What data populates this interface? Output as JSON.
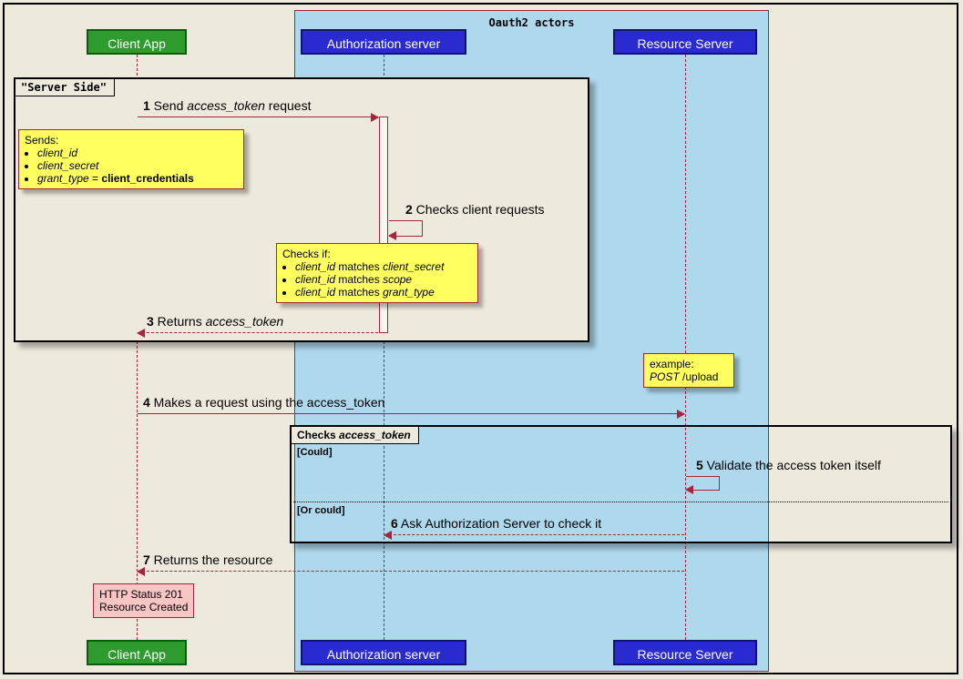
{
  "group_title": "Oauth2 actors",
  "actors": {
    "client": "Client App",
    "auth": "Authorization server",
    "resource": "Resource Server"
  },
  "fragments": {
    "server_side": {
      "label": "\"Server Side\""
    },
    "checks_token": {
      "label_pre": "Checks ",
      "label_em": "access_token",
      "guard1": "[Could]",
      "guard2": "[Or could]"
    }
  },
  "messages": {
    "m1": {
      "num": "1",
      "pre": " Send ",
      "em": "access_token",
      "post": " request"
    },
    "m2": {
      "num": "2",
      "text": " Checks client requests"
    },
    "m3": {
      "num": "3",
      "pre": " Returns ",
      "em": "access_token"
    },
    "m4": {
      "num": "4",
      "text": " Makes a request using the access_token"
    },
    "m5": {
      "num": "5",
      "text": " Validate the access token itself"
    },
    "m6": {
      "num": "6",
      "text": " Ask Authorization Server to check it"
    },
    "m7": {
      "num": "7",
      "text": " Returns the resource"
    }
  },
  "notes": {
    "sends": {
      "title": "Sends:",
      "i1": "client_id",
      "i2": "client_secret",
      "i3_em": "grant_type",
      "i3_mid": " = ",
      "i3_bold": "client_credentials"
    },
    "checks": {
      "title": "Checks if:",
      "i1_a": "client_id",
      "i1_b": " matches ",
      "i1_c": "client_secret",
      "i2_a": "client_id",
      "i2_b": " matches ",
      "i2_c": "scope",
      "i3_a": "client_id",
      "i3_b": " matches ",
      "i3_c": "grant_type"
    },
    "example": {
      "l1": "example:",
      "l2_a": "POST",
      "l2_b": " /upload"
    },
    "result": {
      "l1": "HTTP Status 201",
      "l2": "Resource Created"
    }
  },
  "chart_data": {
    "type": "sequence_diagram",
    "title": "Oauth2 actors",
    "participants": [
      "Client App",
      "Authorization server",
      "Resource Server"
    ],
    "group": {
      "name": "Oauth2 actors",
      "members": [
        "Authorization server",
        "Resource Server"
      ]
    },
    "fragments": [
      {
        "type": "box",
        "label": "\"Server Side\"",
        "covers_steps": [
          1,
          2,
          3
        ]
      },
      {
        "type": "alt",
        "label": "Checks access_token",
        "operands": [
          {
            "guard": "Could",
            "steps": [
              5
            ]
          },
          {
            "guard": "Or could",
            "steps": [
              6
            ]
          }
        ]
      }
    ],
    "steps": [
      {
        "n": 1,
        "from": "Client App",
        "to": "Authorization server",
        "label": "Send access_token request",
        "note": {
          "text": "Sends: client_id, client_secret, grant_type = client_credentials",
          "attached_to": "Client App"
        }
      },
      {
        "n": 2,
        "from": "Authorization server",
        "to": "Authorization server",
        "label": "Checks client requests",
        "note": {
          "text": "Checks if: client_id matches client_secret; client_id matches scope; client_id matches grant_type",
          "attached_to": "Authorization server"
        }
      },
      {
        "n": 3,
        "from": "Authorization server",
        "to": "Client App",
        "label": "Returns access_token",
        "style": "dashed"
      },
      {
        "n": 4,
        "from": "Client App",
        "to": "Resource Server",
        "label": "Makes a request using the access_token",
        "note": {
          "text": "example: POST /upload",
          "attached_to": "Resource Server"
        }
      },
      {
        "n": 5,
        "from": "Resource Server",
        "to": "Resource Server",
        "label": "Validate the access token itself"
      },
      {
        "n": 6,
        "from": "Resource Server",
        "to": "Authorization server",
        "label": "Ask Authorization Server to check it",
        "style": "dashed"
      },
      {
        "n": 7,
        "from": "Resource Server",
        "to": "Client App",
        "label": "Returns the resource",
        "style": "dashed",
        "note": {
          "text": "HTTP Status 201 Resource Created",
          "attached_to": "Client App"
        }
      }
    ]
  }
}
